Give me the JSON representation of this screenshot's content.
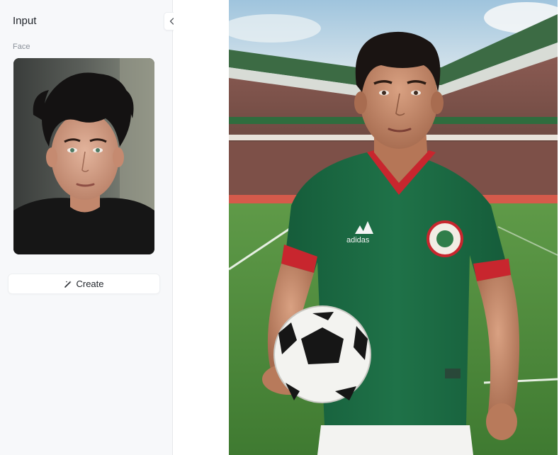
{
  "panel": {
    "title": "Input",
    "collapse_icon": "chevrons-left-icon",
    "face_label": "Face",
    "face_image": "face-portrait-image"
  },
  "actions": {
    "create_label": "Create",
    "create_icon": "magic-wand-icon"
  },
  "result": {
    "image": "generated-soccer-player-image",
    "jersey_text": "adidas"
  },
  "colors": {
    "panel_bg": "#f7f8fa",
    "jersey_green": "#1e6b45",
    "jersey_red": "#c8262e",
    "pitch_green": "#4e8a3c"
  }
}
